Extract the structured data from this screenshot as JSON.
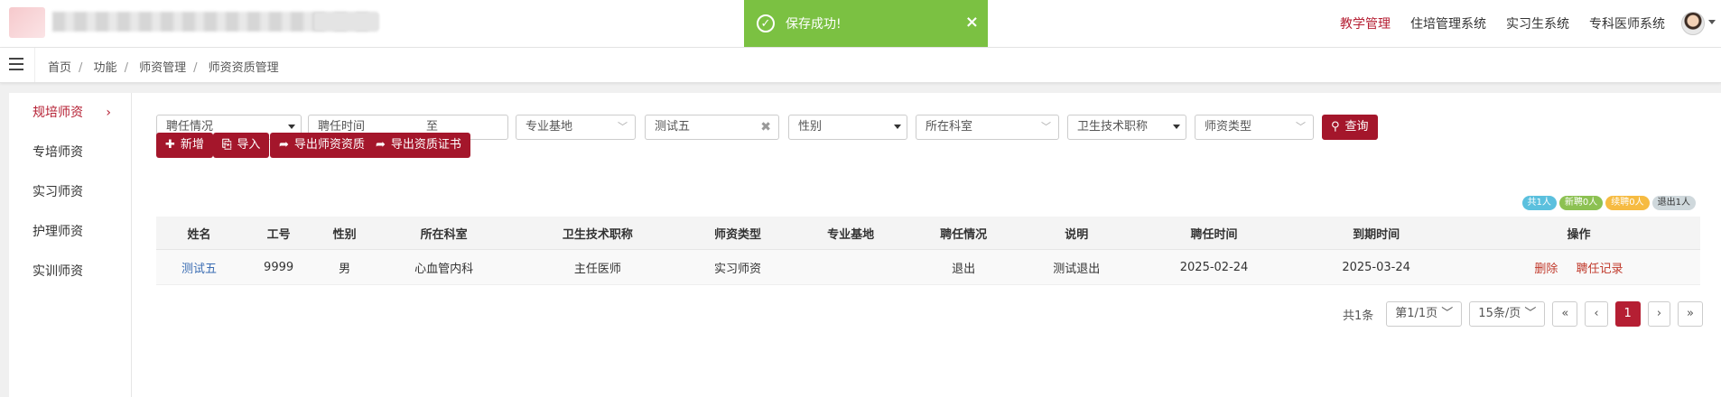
{
  "header": {
    "nav": [
      "教学管理",
      "住培管理系统",
      "实习生系统",
      "专科医师系统"
    ],
    "active_nav_index": 0
  },
  "toast": {
    "message": "保存成功!",
    "close": "×",
    "color": "#7bc142"
  },
  "breadcrumb": [
    "首页",
    "功能",
    "师资管理",
    "师资资质管理"
  ],
  "sidebar": {
    "items": [
      {
        "label": "规培师资",
        "active": true
      },
      {
        "label": "专培师资"
      },
      {
        "label": "实习师资"
      },
      {
        "label": "护理师资"
      },
      {
        "label": "实训师资"
      }
    ],
    "chevron": "›"
  },
  "filters": {
    "employment": "聘任情况",
    "hire_time": "聘任时间",
    "hire_time_to": "至",
    "base": "专业基地",
    "name": "测试五",
    "gender": "性别",
    "dept": "所在科室",
    "title": "卫生技术职称",
    "teacher_type": "师资类型",
    "query": "查询"
  },
  "actions": {
    "add": "新增",
    "import": "导入",
    "export_qual": "导出师资资质",
    "export_cert": "导出资质证书"
  },
  "badges": [
    {
      "text": "共1人",
      "color": "#5bc0de"
    },
    {
      "text": "新聘0人",
      "color": "#8cc152"
    },
    {
      "text": "续聘0人",
      "color": "#f6bb42"
    },
    {
      "text": "退出1人",
      "color": "#cfd8dc",
      "text_color": "#333"
    }
  ],
  "table": {
    "columns": [
      "姓名",
      "工号",
      "性别",
      "所在科室",
      "卫生技术职称",
      "师资类型",
      "专业基地",
      "聘任情况",
      "说明",
      "聘任时间",
      "到期时间",
      "操作"
    ],
    "rows": [
      {
        "name": "测试五",
        "id": "9999",
        "gender": "男",
        "dept": "心血管内科",
        "title": "主任医师",
        "type": "实习师资",
        "base": "",
        "status": "退出",
        "note": "测试退出",
        "start": "2025-02-24",
        "end": "2025-03-24",
        "op_delete": "删除",
        "op_record": "聘任记录"
      }
    ]
  },
  "pager": {
    "total": "共1条",
    "page_select": "第1/1页",
    "size_select": "15条/页",
    "first": "«",
    "prev": "‹",
    "current": "1",
    "next": "›",
    "last": "»"
  },
  "colors": {
    "brand": "#a4162b",
    "active_nav": "#b51f33"
  }
}
